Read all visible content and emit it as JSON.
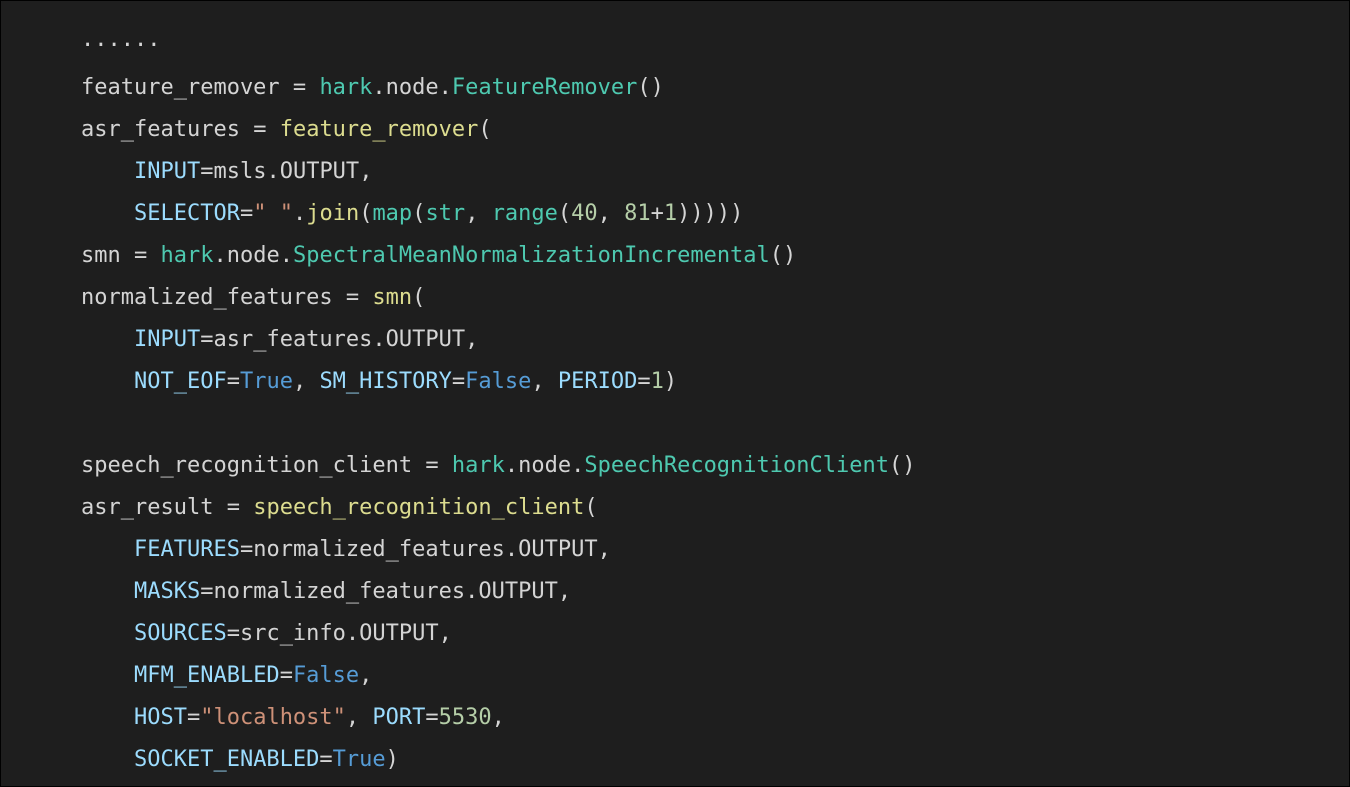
{
  "code": {
    "dots": "······",
    "ids": {
      "feature_remover": "feature_remover",
      "asr_features": "asr_features",
      "smn": "smn",
      "normalized_features": "normalized_features",
      "speech_recognition_client": "speech_recognition_client",
      "asr_result": "asr_result",
      "hark": "hark",
      "node": "node",
      "msls": "msls",
      "src_info": "src_info"
    },
    "types": {
      "FeatureRemover": "FeatureRemover",
      "SpectralMeanNormalizationIncremental": "SpectralMeanNormalizationIncremental",
      "SpeechRecognitionClient": "SpeechRecognitionClient"
    },
    "attrs": {
      "OUTPUT": "OUTPUT"
    },
    "builtins": {
      "join": "join",
      "map": "map",
      "str": "str",
      "range": "range"
    },
    "params": {
      "INPUT": "INPUT",
      "SELECTOR": "SELECTOR",
      "NOT_EOF": "NOT_EOF",
      "SM_HISTORY": "SM_HISTORY",
      "PERIOD": "PERIOD",
      "FEATURES": "FEATURES",
      "MASKS": "MASKS",
      "SOURCES": "SOURCES",
      "MFM_ENABLED": "MFM_ENABLED",
      "HOST": "HOST",
      "PORT": "PORT",
      "SOCKET_ENABLED": "SOCKET_ENABLED"
    },
    "strings": {
      "space": "\" \"",
      "localhost": "\"localhost\""
    },
    "numbers": {
      "n40": "40",
      "n81": "81",
      "n1a": "1",
      "n1b": "1",
      "n5530": "5530"
    },
    "bools": {
      "True1": "True",
      "False1": "False",
      "False2": "False",
      "True2": "True"
    },
    "ops": {
      "eq": " = ",
      "assign": "=",
      "plus": "+",
      "dot": ".",
      "comma_sp": ", ",
      "comma": ",",
      "lpar": "(",
      "rpar": ")",
      "rpar2": "))",
      "rpar4": "))))",
      "empty_parens": "()"
    }
  }
}
